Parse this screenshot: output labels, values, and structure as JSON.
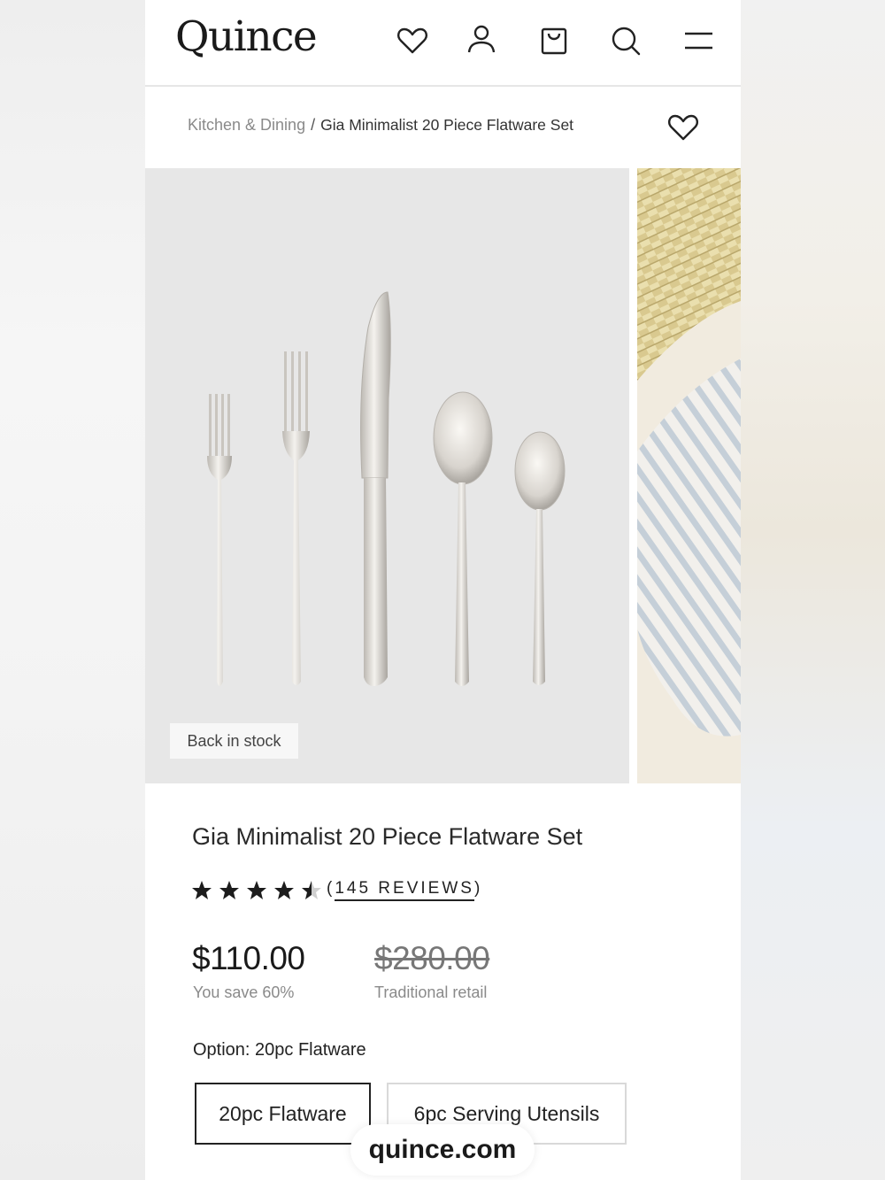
{
  "brand": {
    "logo_text": "Quince"
  },
  "header": {
    "icons": [
      "heart-icon",
      "account-icon",
      "bag-icon",
      "search-icon",
      "menu-icon"
    ]
  },
  "breadcrumb": {
    "parent": "Kitchen & Dining",
    "separator": "/",
    "current": "Gia Minimalist 20 Piece Flatware Set"
  },
  "gallery": {
    "badge": "Back in stock",
    "background": "#e7e7e7"
  },
  "product": {
    "title": "Gia Minimalist 20 Piece Flatware Set",
    "rating": 4.5,
    "reviews_open": "(",
    "reviews_link": "145 REVIEWS",
    "reviews_close": ")",
    "price": "$110.00",
    "savings": "You save 60%",
    "retail_price": "$280.00",
    "retail_label": "Traditional retail"
  },
  "options": {
    "label": "Option: 20pc Flatware",
    "items": [
      {
        "label": "20pc Flatware",
        "selected": true
      },
      {
        "label": "6pc Serving Utensils",
        "selected": false
      }
    ]
  },
  "watermark": {
    "text": "quince.com"
  }
}
